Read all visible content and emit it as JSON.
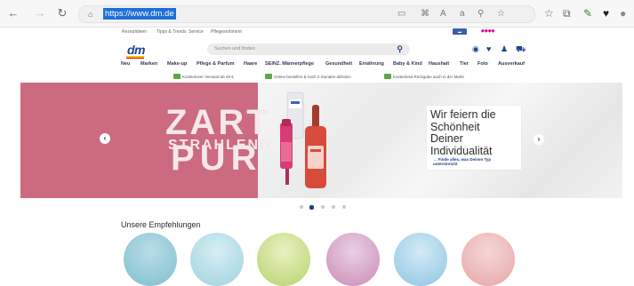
{
  "browser": {
    "url": "https://www.dm.de"
  },
  "meta_links": [
    "Rezeptideen",
    "Tipps & Trends",
    "Service",
    "Pflegesortiment"
  ],
  "header": {
    "logo_text": "dm",
    "search_placeholder": "Suchen und finden"
  },
  "nav": [
    "Neu",
    "Marken",
    "Make-up",
    "Pflege & Parfum",
    "Haare",
    "SEINZ. Männerpflege",
    "Gesundheit",
    "Ernährung",
    "Baby & Kind",
    "Haushalt",
    "Tier",
    "Foto",
    "Ausverkauf"
  ],
  "usps": [
    "Kostenloser Versand ab 49 €",
    "Online bestellen & nach 2 Stunden abholen",
    "Kostenlose Rückgabe auch in der Markt"
  ],
  "hero": {
    "line1": "ZART",
    "line2": "STRAHLEND",
    "line3": "PUR",
    "headline": "Wir feiern die\nSchönheit\nDeiner\nIndividualität",
    "link": "→ Finde alles, was Deinen Typ unterstreicht"
  },
  "carousel": {
    "count": 5,
    "active_index": 1
  },
  "recommendations": {
    "title": "Unsere Empfehlungen"
  },
  "colors": {
    "brand_blue": "#1d3f8f",
    "hero_pink": "#cc6a80",
    "url_highlight": "#1f6fd6"
  },
  "icons": [
    "back-icon",
    "forward-icon",
    "reload-icon",
    "lock-icon",
    "reader-view-icon",
    "translate-icon",
    "zoom-icon",
    "favorite-star-icon",
    "collections-icon",
    "extension-icon",
    "profile-icon",
    "location-icon",
    "heart-icon",
    "account-icon",
    "cart-icon",
    "search-icon"
  ]
}
